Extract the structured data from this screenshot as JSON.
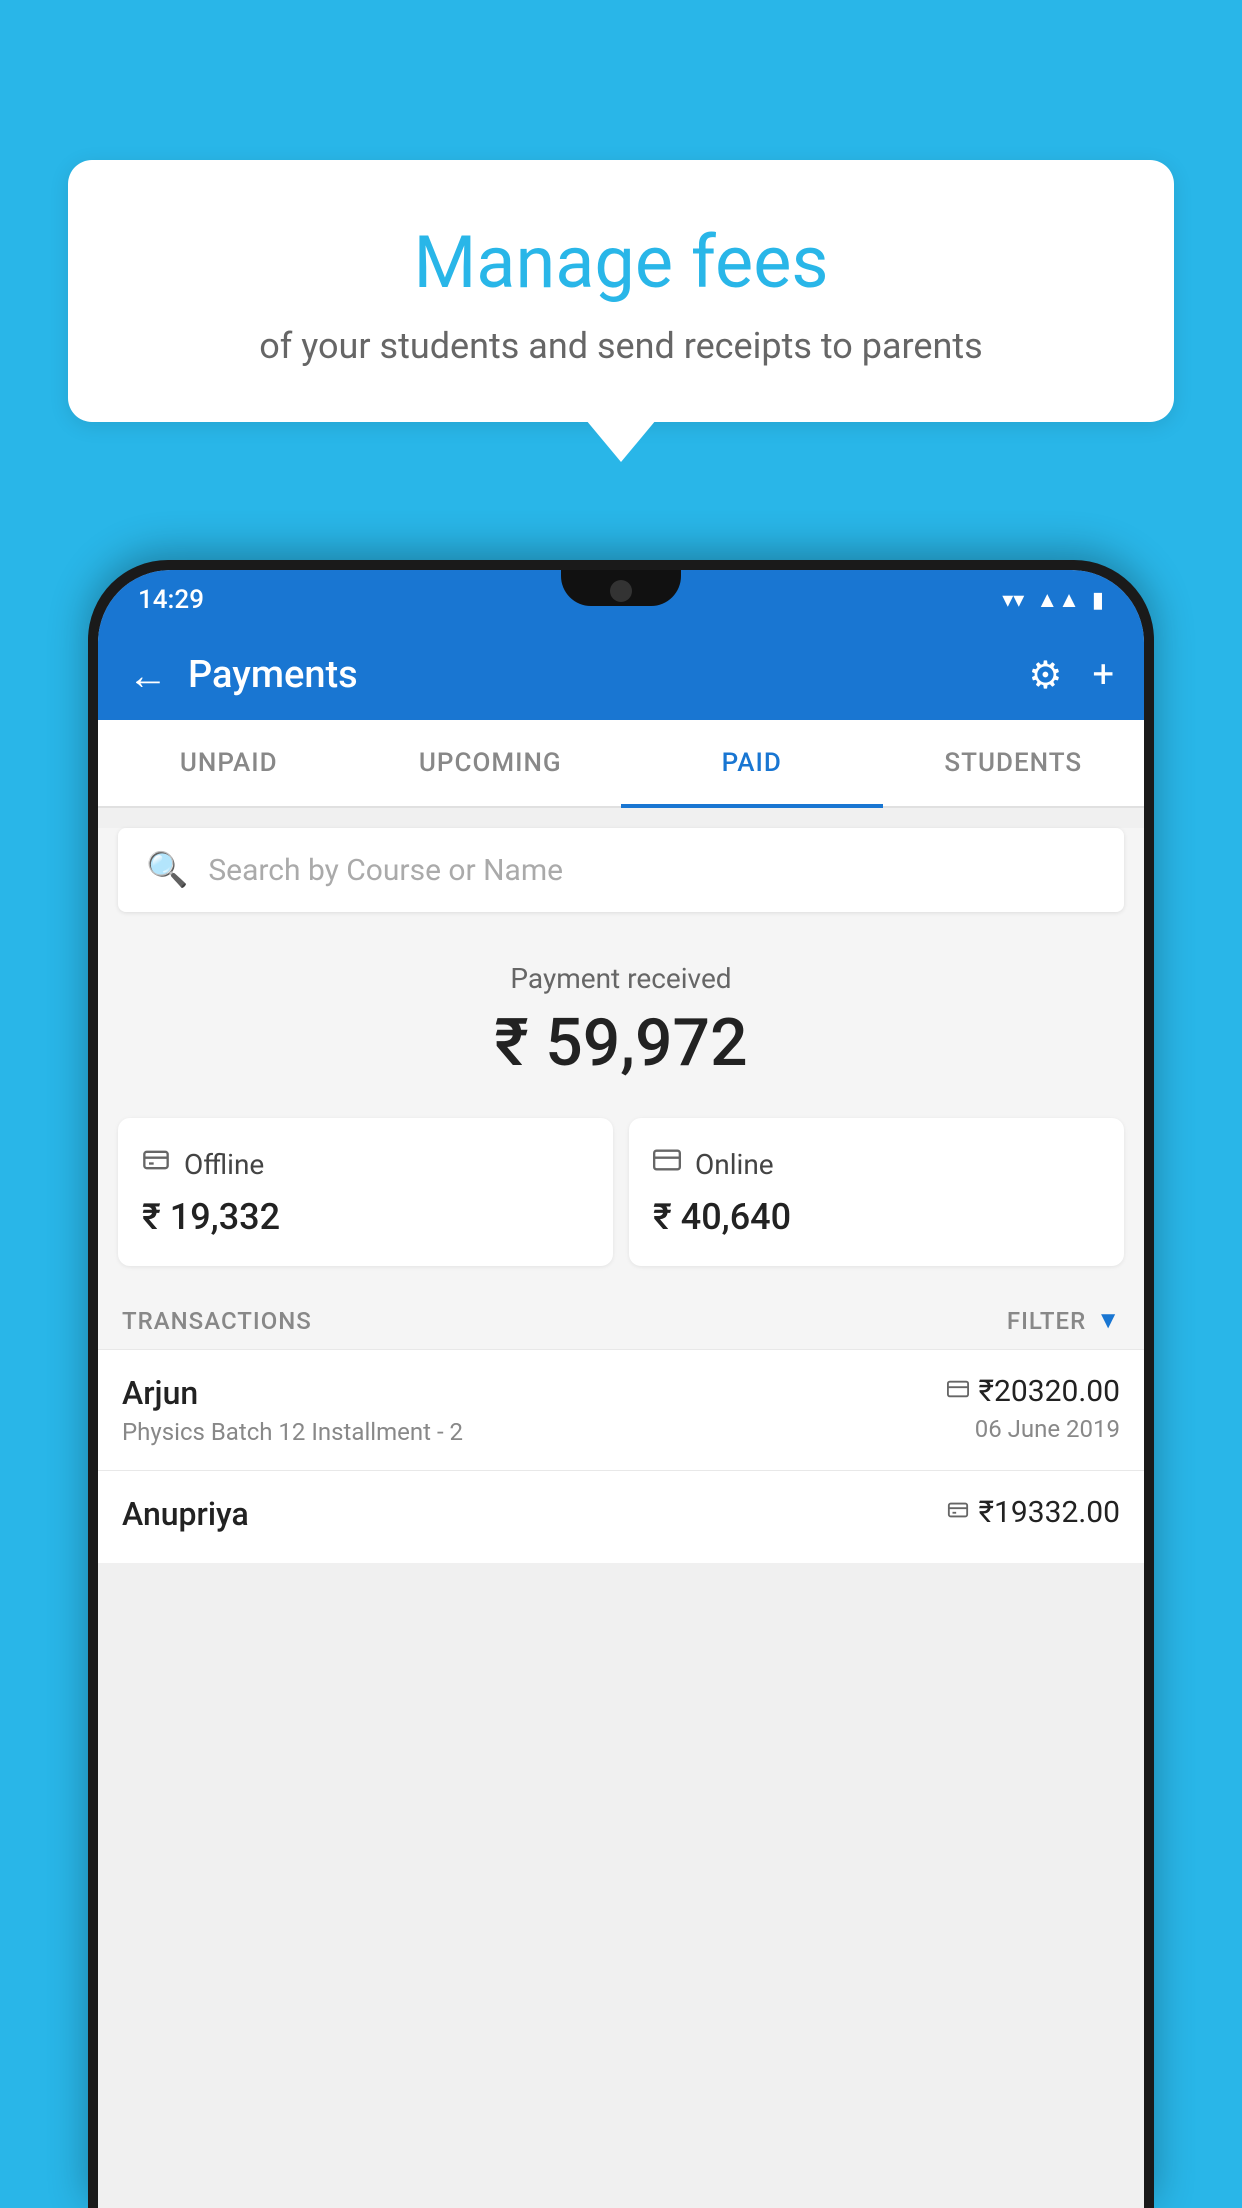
{
  "background": {
    "color": "#29B6E8"
  },
  "bubble": {
    "title": "Manage fees",
    "subtitle": "of your students and send receipts to parents"
  },
  "statusBar": {
    "time": "14:29",
    "icons": [
      "wifi",
      "signal",
      "battery"
    ]
  },
  "appBar": {
    "title": "Payments",
    "backLabel": "←",
    "gearLabel": "⚙",
    "plusLabel": "+"
  },
  "tabs": [
    {
      "id": "unpaid",
      "label": "UNPAID",
      "active": false
    },
    {
      "id": "upcoming",
      "label": "UPCOMING",
      "active": false
    },
    {
      "id": "paid",
      "label": "PAID",
      "active": true
    },
    {
      "id": "students",
      "label": "STUDENTS",
      "active": false
    }
  ],
  "search": {
    "placeholder": "Search by Course or Name",
    "icon": "🔍"
  },
  "paymentReceived": {
    "label": "Payment received",
    "amount": "₹ 59,972"
  },
  "paymentCards": [
    {
      "id": "offline",
      "icon": "₹",
      "type": "Offline",
      "amount": "₹ 19,332"
    },
    {
      "id": "online",
      "icon": "💳",
      "type": "Online",
      "amount": "₹ 40,640"
    }
  ],
  "transactions": {
    "label": "TRANSACTIONS",
    "filterLabel": "FILTER",
    "filterIcon": "▼",
    "rows": [
      {
        "id": "arjun",
        "name": "Arjun",
        "description": "Physics Batch 12 Installment - 2",
        "amountIcon": "💳",
        "amount": "₹20320.00",
        "date": "06 June 2019"
      },
      {
        "id": "anupriya",
        "name": "Anupriya",
        "description": "",
        "amountIcon": "₹",
        "amount": "₹19332.00",
        "date": ""
      }
    ]
  }
}
